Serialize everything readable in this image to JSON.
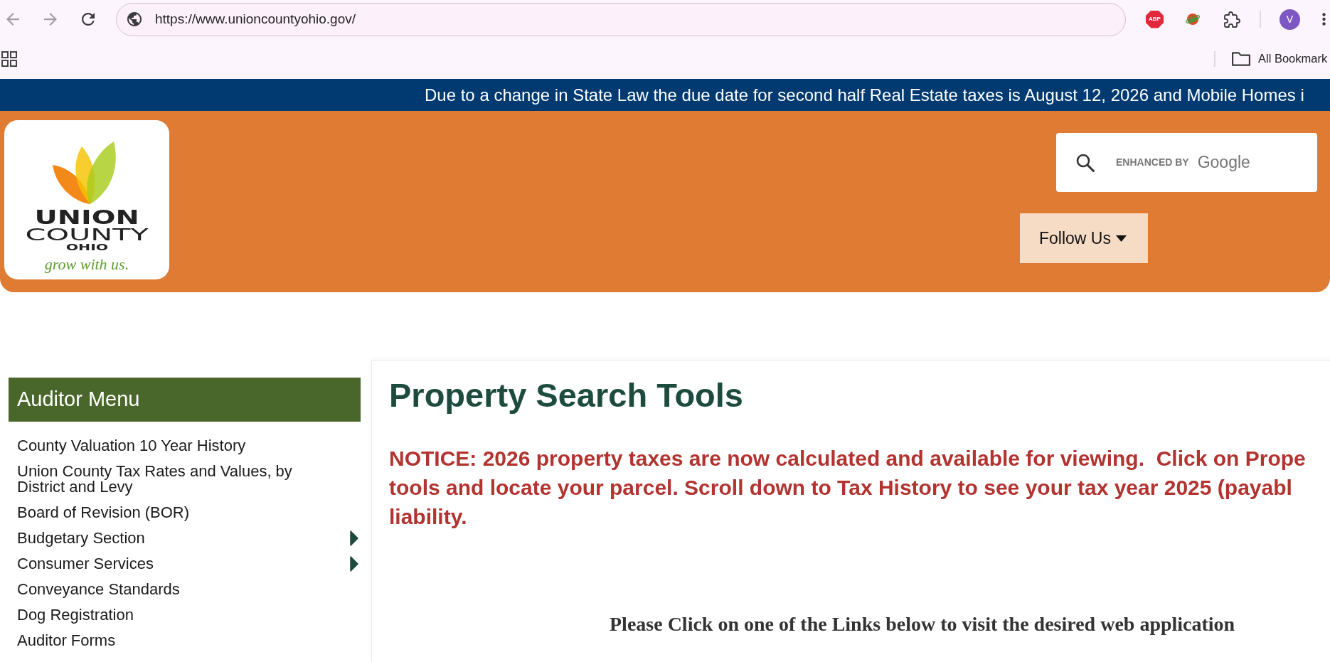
{
  "browser": {
    "nav_buttons": [
      {
        "kind": "back",
        "disabled": true
      },
      {
        "kind": "forward",
        "disabled": true
      },
      {
        "kind": "reload",
        "disabled": false
      }
    ],
    "url": "https://www.unioncountyohio.gov/",
    "extensions": [
      {
        "kind": "octagon",
        "label": "ABP"
      },
      {
        "kind": "planet"
      },
      {
        "kind": "puzzle"
      }
    ],
    "profile": {
      "initial": "V"
    },
    "bookmarks_bar": {
      "folder_label": "All Bookmark"
    }
  },
  "banner": {
    "text": "Due to a change in State Law the due date for second half Real Estate taxes is August 12, 2026 and Mobile Homes i"
  },
  "header": {
    "logo": {
      "name_lines": [
        "UNION",
        "COUNTY"
      ],
      "state": "OHIO",
      "tagline": "grow with us."
    },
    "search": {
      "brand_prefix": "ENHANCED BY",
      "brand_name": "Google"
    },
    "follow_button": {
      "label": "Follow Us"
    }
  },
  "sidebar": {
    "title": "Auditor Menu",
    "items": [
      {
        "label": "County Valuation 10 Year History",
        "kind": "link"
      },
      {
        "label": "Union County Tax Rates and Values, by District and Levy",
        "kind": "link"
      },
      {
        "label": "Board of Revision (BOR)",
        "kind": "link"
      },
      {
        "label": "Budgetary Section",
        "kind": "submenu"
      },
      {
        "label": "Consumer Services",
        "kind": "submenu"
      },
      {
        "label": "Conveyance Standards",
        "kind": "link"
      },
      {
        "label": "Dog Registration",
        "kind": "link"
      },
      {
        "label": "Auditor Forms",
        "kind": "link"
      }
    ]
  },
  "content": {
    "title": "Property Search Tools",
    "notice_lines": [
      "NOTICE: 2026 property taxes are now calculated and available for viewing.  Click on Prope",
      "tools and locate your parcel. Scroll down to Tax History to see your tax year 2025 (payabl",
      "liability."
    ],
    "instruction": "Please Click on one of the Links below to visit the desired web application"
  }
}
